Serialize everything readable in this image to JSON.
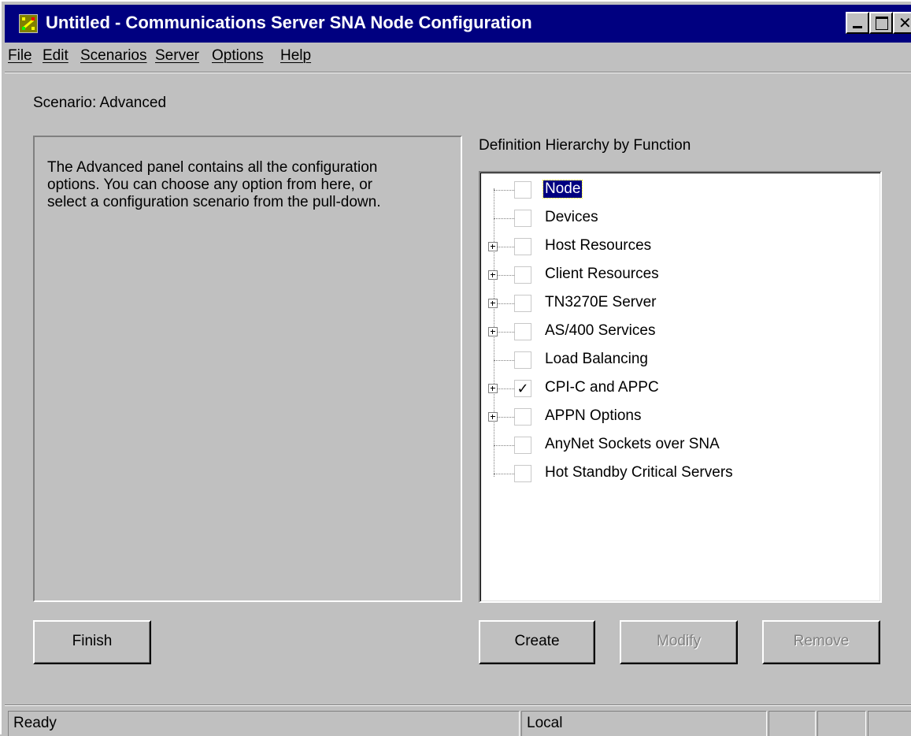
{
  "window": {
    "title": "Untitled - Communications Server SNA Node Configuration"
  },
  "menu": {
    "items": [
      "File",
      "Edit",
      "Scenarios",
      "Server",
      "Options",
      "Help"
    ]
  },
  "scenario_label": "Scenario: Advanced",
  "description": "The Advanced panel contains all the configuration\noptions. You can choose any option from here, or\nselect a configuration scenario from the pull-down.",
  "tree": {
    "heading": "Definition Hierarchy by Function",
    "check_glyph": "✓",
    "items": [
      {
        "label": "Node",
        "expandable": false,
        "checked": false,
        "selected": true
      },
      {
        "label": "Devices",
        "expandable": false,
        "checked": false,
        "selected": false
      },
      {
        "label": "Host Resources",
        "expandable": true,
        "checked": false,
        "selected": false
      },
      {
        "label": "Client Resources",
        "expandable": true,
        "checked": false,
        "selected": false
      },
      {
        "label": "TN3270E Server",
        "expandable": true,
        "checked": false,
        "selected": false
      },
      {
        "label": "AS/400 Services",
        "expandable": true,
        "checked": false,
        "selected": false
      },
      {
        "label": "Load Balancing",
        "expandable": false,
        "checked": false,
        "selected": false
      },
      {
        "label": "CPI-C and APPC",
        "expandable": true,
        "checked": true,
        "selected": false
      },
      {
        "label": "APPN Options",
        "expandable": true,
        "checked": false,
        "selected": false
      },
      {
        "label": "AnyNet Sockets over SNA",
        "expandable": false,
        "checked": false,
        "selected": false
      },
      {
        "label": "Hot Standby Critical Servers",
        "expandable": false,
        "checked": false,
        "selected": false
      }
    ]
  },
  "buttons": {
    "finish": "Finish",
    "create": "Create",
    "modify": "Modify",
    "remove": "Remove"
  },
  "status": {
    "message": "Ready",
    "location": "Local",
    "extra1": "",
    "extra2": "",
    "extra3": ""
  },
  "colors": {
    "titlebar": "#000080",
    "face": "#c0c0c0",
    "selection": "#000080"
  }
}
